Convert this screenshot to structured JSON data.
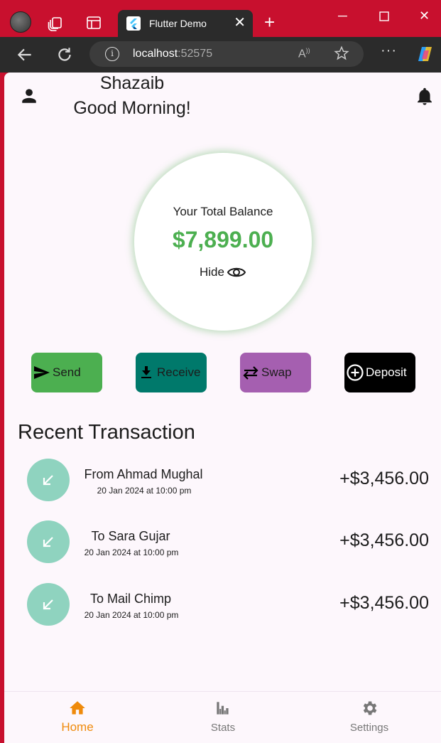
{
  "browser": {
    "tab_title": "Flutter Demo",
    "url_host": "localhost",
    "url_port": ":52575"
  },
  "header": {
    "user_name": "Shazaib",
    "greeting": "Good Morning!"
  },
  "balance": {
    "label": "Your Total Balance",
    "amount": "$7,899.00",
    "hide_label": "Hide",
    "amount_color": "#4caf50"
  },
  "actions": [
    {
      "label": "Send",
      "icon": "send-icon",
      "color": "#4caf50"
    },
    {
      "label": "Receive",
      "icon": "download-icon",
      "color": "#00796b"
    },
    {
      "label": "Swap",
      "icon": "swap-icon",
      "color": "#a55fb0"
    },
    {
      "label": "Deposit",
      "icon": "add-circle-icon",
      "color": "#000000"
    }
  ],
  "transactions": {
    "title": "Recent Transaction",
    "items": [
      {
        "title": "From Ahmad Mughal",
        "date": "20 Jan 2024 at 10:00 pm",
        "amount": "+$3,456.00",
        "icon": "arrow-down-left-icon"
      },
      {
        "title": "To Sara Gujar",
        "date": "20 Jan 2024 at 10:00 pm",
        "amount": "+$3,456.00",
        "icon": "arrow-down-left-icon"
      },
      {
        "title": "To Mail Chimp",
        "date": "20 Jan 2024 at 10:00 pm",
        "amount": "+$3,456.00",
        "icon": "arrow-down-left-icon"
      }
    ]
  },
  "bottom_nav": {
    "items": [
      {
        "label": "Home",
        "icon": "home-icon",
        "active": true
      },
      {
        "label": "Stats",
        "icon": "stats-icon",
        "active": false
      },
      {
        "label": "Settings",
        "icon": "gear-icon",
        "active": false
      }
    ],
    "active_color": "#ef8a0b"
  }
}
